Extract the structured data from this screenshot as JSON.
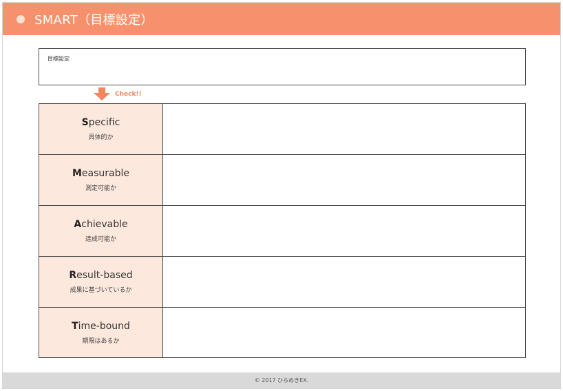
{
  "header": {
    "title": "SMART（目標設定）"
  },
  "goal": {
    "label": "目標設定"
  },
  "check": {
    "text": "Check!!"
  },
  "rows": [
    {
      "initial": "S",
      "rest": "pecific",
      "sub": "具体的か"
    },
    {
      "initial": "M",
      "rest": "easurable",
      "sub": "測定可能か"
    },
    {
      "initial": "A",
      "rest": "chievable",
      "sub": "達成可能か"
    },
    {
      "initial": "R",
      "rest": "esult-based",
      "sub": "成果に基づいているか"
    },
    {
      "initial": "T",
      "rest": "ime-bound",
      "sub": "期限はあるか"
    }
  ],
  "footer": {
    "copyright": "© 2017 ひらめきEX."
  },
  "colors": {
    "header": "#f7916d",
    "label_bg": "#fde8dd",
    "accent": "#f2875f"
  }
}
